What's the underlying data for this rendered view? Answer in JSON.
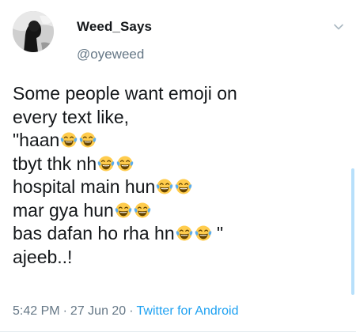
{
  "author": {
    "display_name": "Weed_Says",
    "handle": "@oyeweed",
    "avatar_icon": "profile-avatar"
  },
  "tweet": {
    "lines": [
      {
        "text": "Some people want emoji on",
        "emojis": 0,
        "trail": ""
      },
      {
        "text": "every text like,",
        "emojis": 0,
        "trail": ""
      },
      {
        "text": "\"haan",
        "emojis": 2,
        "trail": ""
      },
      {
        "text": "tbyt thk nh",
        "emojis": 2,
        "trail": ""
      },
      {
        "text": "hospital main hun",
        "emojis": 2,
        "trail": ""
      },
      {
        "text": "mar gya hun",
        "emojis": 2,
        "trail": ""
      },
      {
        "text": "bas dafan ho rha hn",
        "emojis": 2,
        "trail": " \""
      },
      {
        "text": "ajeeb..!",
        "emojis": 0,
        "trail": ""
      }
    ],
    "emoji_name": "face-with-tears-of-joy"
  },
  "meta": {
    "time": "5:42 PM",
    "separator": "·",
    "date": "27 Jun 20",
    "source": "Twitter for Android"
  },
  "colors": {
    "link": "#1da1f2",
    "secondary_text": "#657786",
    "primary_text": "#14171a"
  }
}
